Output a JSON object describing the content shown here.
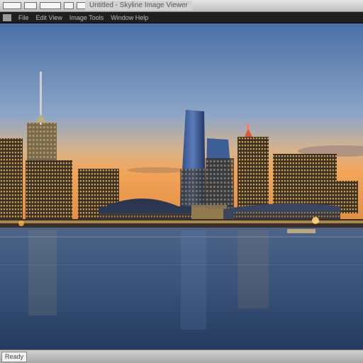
{
  "window": {
    "title": "Untitled - Skyline Image Viewer"
  },
  "menu": {
    "items": [
      "File",
      "Edit View",
      "Image Tools",
      "Window Help"
    ]
  },
  "status": {
    "text": "Ready"
  },
  "colors": {
    "sky_top": "#4a6fa8",
    "sky_horizon": "#f2a55a",
    "water": "#3a5278",
    "lights": "#ffcf6a"
  }
}
